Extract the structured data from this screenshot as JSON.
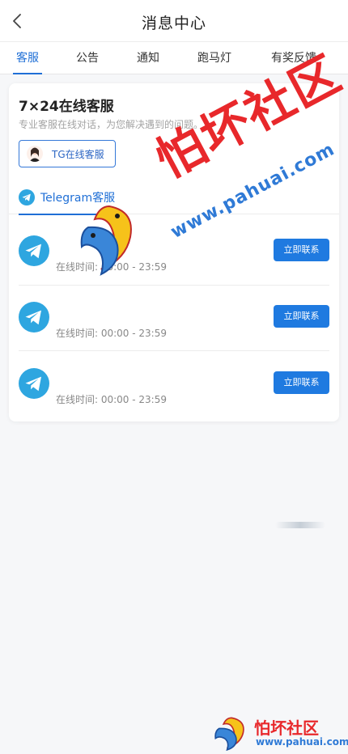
{
  "header": {
    "title": "消息中心"
  },
  "tabs": [
    {
      "label": "客服",
      "active": true
    },
    {
      "label": "公告",
      "active": false
    },
    {
      "label": "通知",
      "active": false
    },
    {
      "label": "跑马灯",
      "active": false
    },
    {
      "label": "有奖反馈",
      "active": false
    }
  ],
  "card": {
    "title": "7×24在线客服",
    "subtitle": "专业客服在线对话，为您解决遇到的问题。",
    "support_button_label": "TG在线客服",
    "sub_tab_label": "Telegram客服",
    "agents": [
      {
        "hours": "在线时间: 00:00 - 23:59",
        "button_label": "立即联系"
      },
      {
        "hours": "在线时间: 00:00 - 23:59",
        "button_label": "立即联系"
      },
      {
        "hours": "在线时间: 00:00 - 23:59",
        "button_label": "立即联系"
      }
    ]
  },
  "watermark": {
    "name": "怕坏社区",
    "url": "www.pahuai.com"
  },
  "footer_logo": {
    "name": "怕坏社区",
    "url": "www.pahuai.com"
  },
  "colors": {
    "accent": "#1f6fd6",
    "button": "#1f7ae0",
    "telegram": "#2ea6e0",
    "watermark_red": "#e8282b",
    "watermark_blue": "#2f7ad6"
  },
  "icons": {
    "back": "chevron-left-icon",
    "telegram": "telegram-icon",
    "avatar": "avatar"
  }
}
